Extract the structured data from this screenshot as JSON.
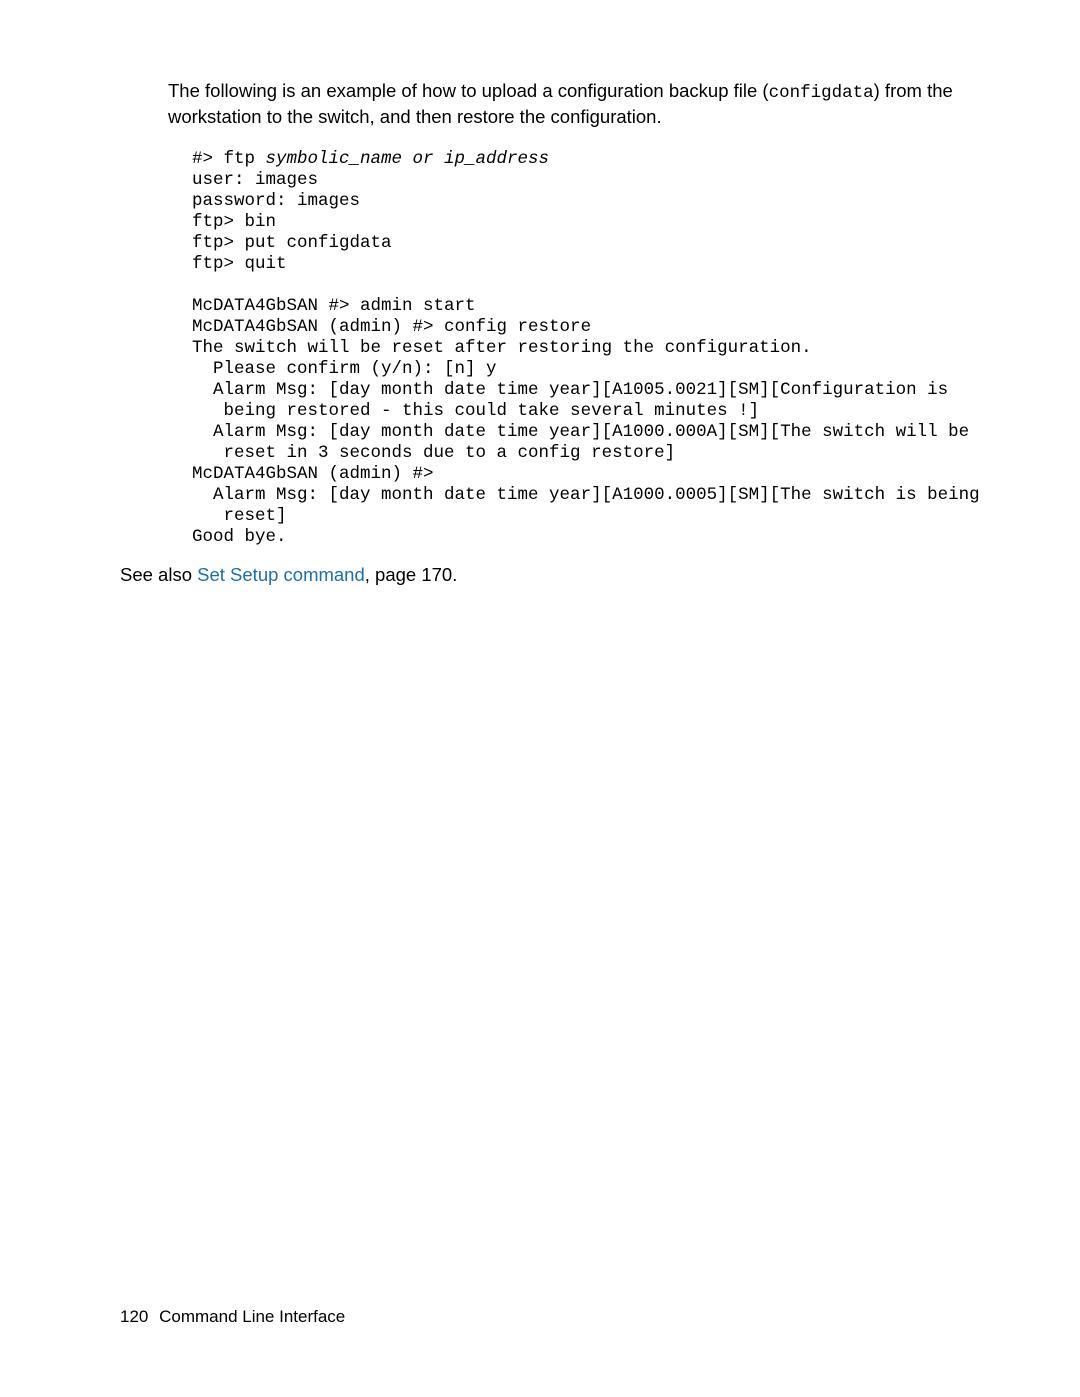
{
  "intro": {
    "part1": "The following is an example of how to upload a configuration backup file (",
    "code": "configdata",
    "part2": ") from the workstation to the switch, and then restore the configuration."
  },
  "code": {
    "l1a": "#> ftp ",
    "l1b": "symbolic_name or ip_address",
    "l2": "user: images",
    "l3": "password: images",
    "l4": "ftp> bin",
    "l5": "ftp> put configdata",
    "l6": "ftp> quit",
    "l7": "",
    "l8": "McDATA4GbSAN #> admin start",
    "l9": "McDATA4GbSAN (admin) #> config restore",
    "l10": "The switch will be reset after restoring the configuration.",
    "l11": "  Please confirm (y/n): [n] y",
    "l12": "  Alarm Msg: [day month date time year][A1005.0021][SM][Configuration is",
    "l13": "   being restored - this could take several minutes !]",
    "l14": "  Alarm Msg: [day month date time year][A1000.000A][SM][The switch will be",
    "l15": "   reset in 3 seconds due to a config restore]",
    "l16": "McDATA4GbSAN (admin) #>",
    "l17": "  Alarm Msg: [day month date time year][A1000.0005][SM][The switch is being",
    "l18": "   reset]",
    "l19": "Good bye."
  },
  "see_also": {
    "label": "See also",
    "link": "Set Setup command",
    "suffix": ", page 170."
  },
  "footer": {
    "page": "120",
    "section": "Command Line Interface"
  }
}
